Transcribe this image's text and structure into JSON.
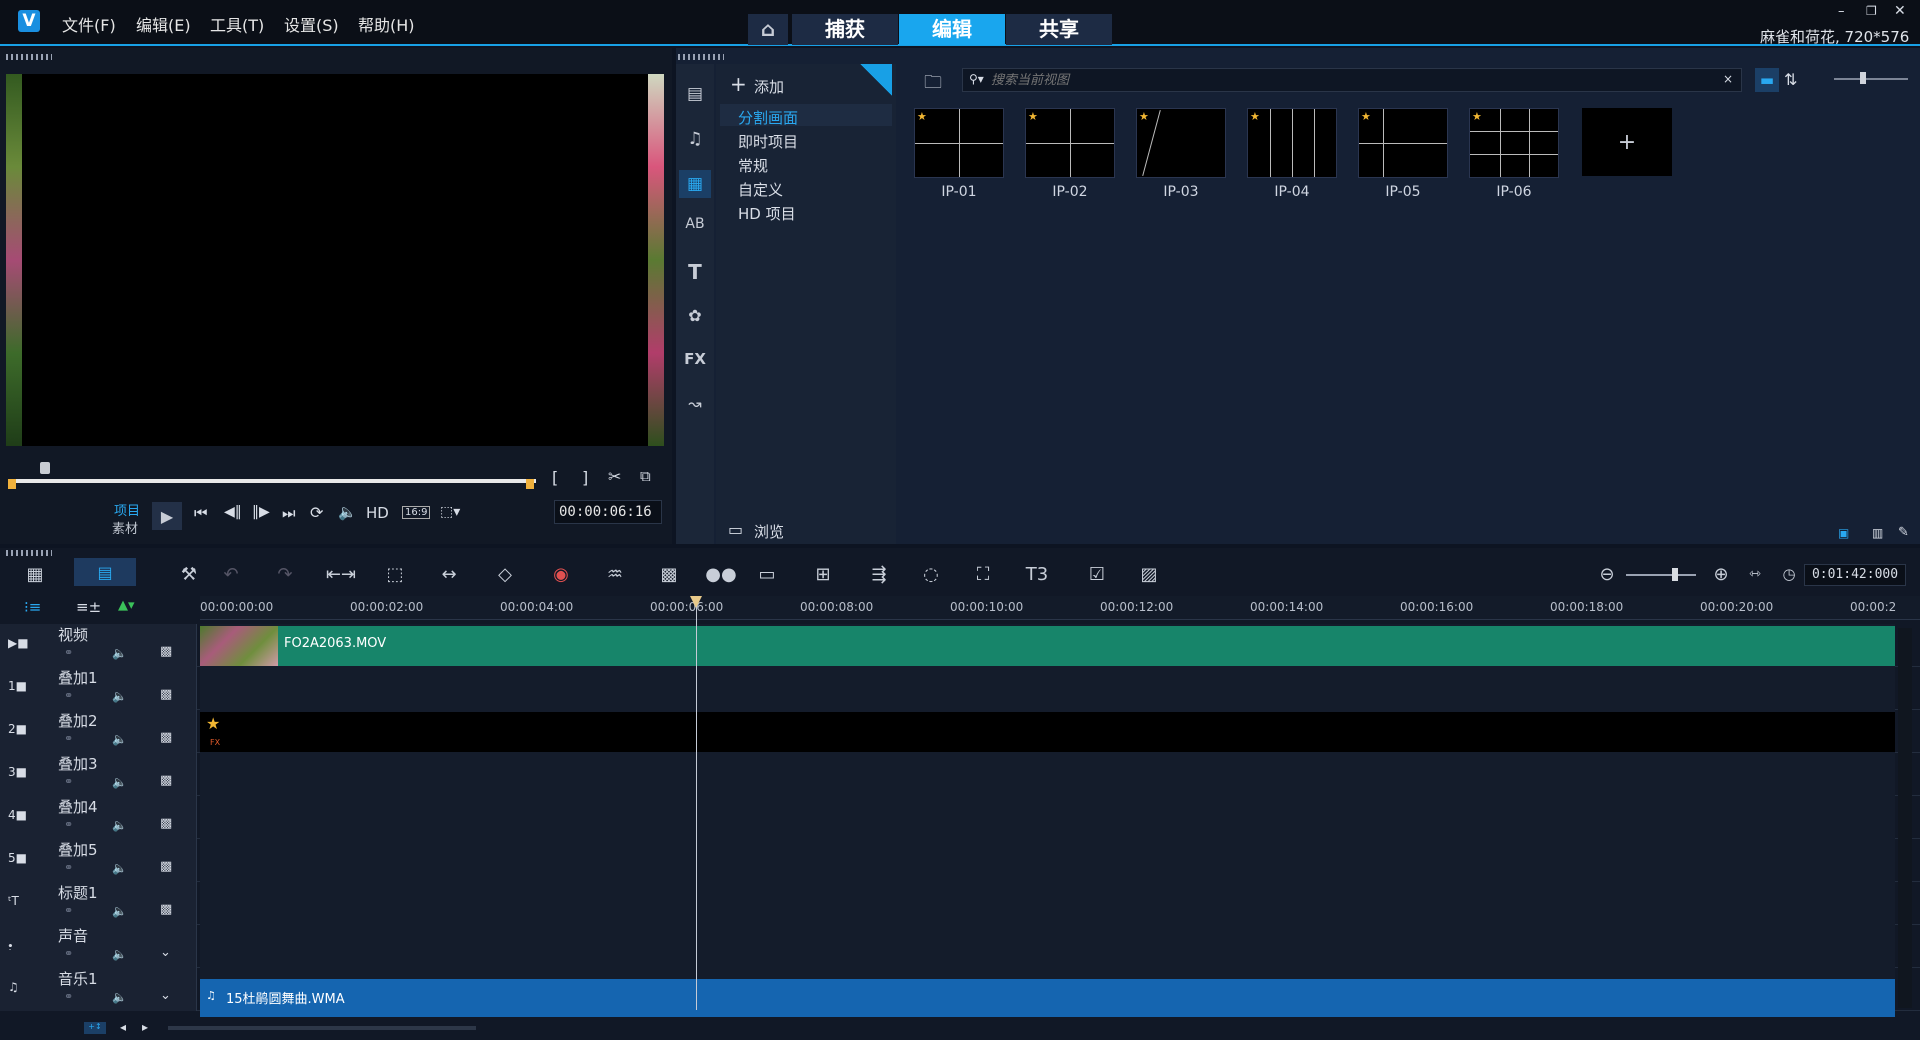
{
  "app": {
    "logo_text": "V",
    "project_info": "麻雀和荷花, 720*576"
  },
  "menu": [
    "文件(F)",
    "编辑(E)",
    "工具(T)",
    "设置(S)",
    "帮助(H)"
  ],
  "tabs": [
    {
      "label": "捕获"
    },
    {
      "label": "编辑"
    },
    {
      "label": "共享"
    }
  ],
  "player": {
    "mode_project": "项目",
    "mode_clip": "素材",
    "hd": "HD",
    "aspect": "16:9",
    "timecode": "00:00:06:16",
    "trim_in": "[",
    "trim_out": "]"
  },
  "library": {
    "add_label": "添加",
    "search_placeholder": "搜索当前视图",
    "browse_label": "浏览",
    "categories": [
      "分割画面",
      "即时项目",
      "常规",
      "自定义",
      "HD 项目"
    ],
    "items": [
      "IP-01",
      "IP-02",
      "IP-03",
      "IP-04",
      "IP-05",
      "IP-06"
    ],
    "add_item": "+"
  },
  "timeline": {
    "duration": "0:01:42:000",
    "ruler": [
      "00:00:00:00",
      "00:00:02:00",
      "00:00:04:00",
      "00:00:06:00",
      "00:00:08:00",
      "00:00:10:00",
      "00:00:12:00",
      "00:00:14:00",
      "00:00:16:00",
      "00:00:18:00",
      "00:00:20:00",
      "00:00:2"
    ],
    "tracks": [
      {
        "label": "视频"
      },
      {
        "label": "叠加1"
      },
      {
        "label": "叠加2"
      },
      {
        "label": "叠加3"
      },
      {
        "label": "叠加4"
      },
      {
        "label": "叠加5"
      },
      {
        "label": "标题1"
      },
      {
        "label": "声音"
      },
      {
        "label": "音乐1"
      }
    ],
    "video_clip": "FO2A2063.MOV",
    "music_clip": "15杜鹃圆舞曲.WMA",
    "fx_label": "FX"
  },
  "colors": {
    "accent": "#19a6ee",
    "video_clip": "#17856a",
    "music_clip": "#1565b0"
  }
}
